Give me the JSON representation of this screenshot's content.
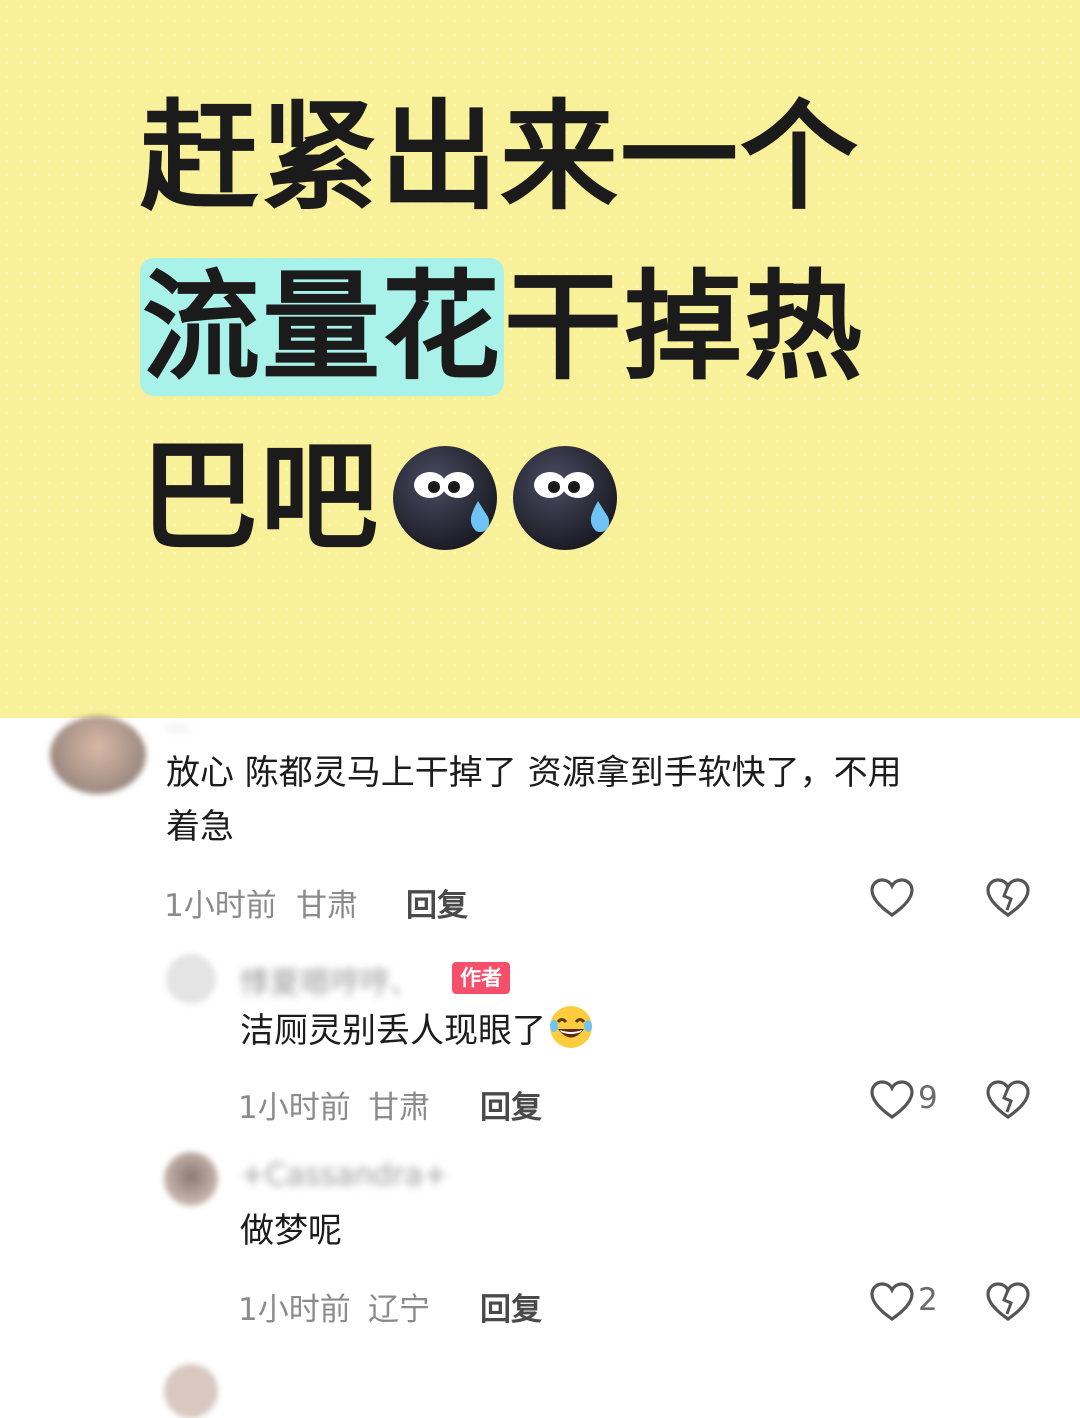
{
  "headline": {
    "line1": "赶紧出来一个",
    "line2_highlight": "流量花",
    "line2_rest": "干掉热",
    "line3": "巴吧",
    "emoji": "sweat-face-icon"
  },
  "comments": [
    {
      "username": "...",
      "text_line1": "放心 陈都灵马上干掉了 资源拿到手软快了，不用",
      "text_line2": "着急",
      "time": "1小时前",
      "location": "甘肃",
      "reply_label": "回复",
      "likes": ""
    },
    {
      "username": "悸夏嗯哼哼、",
      "badge": "作者",
      "text": "洁厕灵别丢人现眼了",
      "emoji": "laughing-tears-icon",
      "time": "1小时前",
      "location": "甘肃",
      "reply_label": "回复",
      "likes": "9"
    },
    {
      "username": "+Cassandra+",
      "text": "做梦呢",
      "time": "1小时前",
      "location": "辽宁",
      "reply_label": "回复",
      "likes": "2"
    }
  ],
  "colors": {
    "banner_bg": "#f8f19a",
    "highlight": "#a9f2ea",
    "badge": "#f4506b"
  }
}
